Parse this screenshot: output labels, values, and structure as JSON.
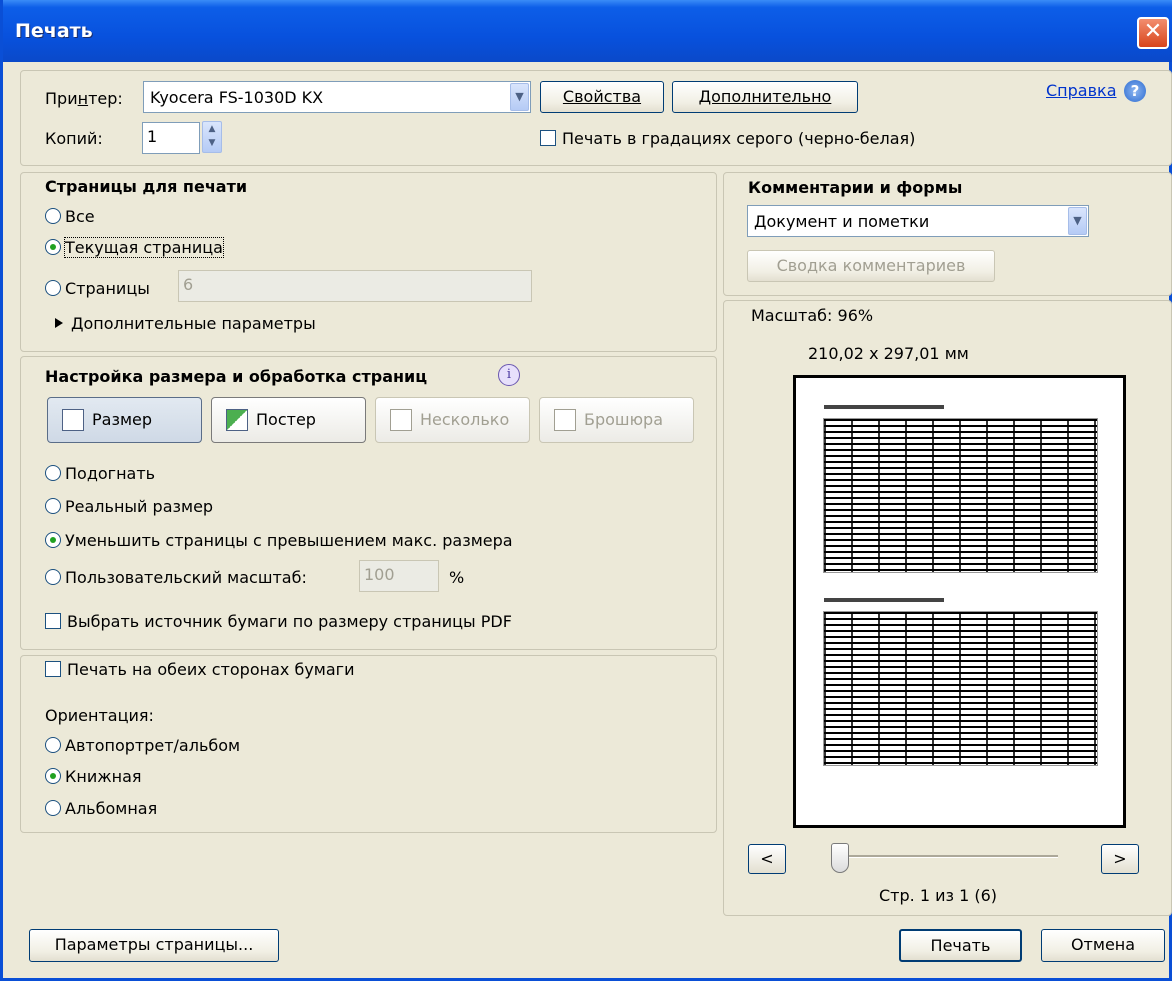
{
  "window": {
    "title": "Печать",
    "close_label": "✕"
  },
  "printer": {
    "label": "Принтер:",
    "value": "Kyocera FS-1030D KX",
    "properties_button": "Свойства",
    "advanced_button": "Дополнительно",
    "help_link": "Справка",
    "copies_label": "Копий:",
    "copies_value": "1",
    "grayscale_label": "Печать в градациях серого (черно-белая)"
  },
  "pages": {
    "heading": "Страницы для печати",
    "all": "Все",
    "current": "Текущая страница",
    "range": "Страницы",
    "range_value": "6",
    "more_options": "Дополнительные параметры"
  },
  "sizing": {
    "heading": "Настройка размера и обработка страниц",
    "btn_size": "Размер",
    "btn_poster": "Постер",
    "btn_multiple": "Несколько",
    "btn_booklet": "Брошюра",
    "fit": "Подогнать",
    "actual": "Реальный размер",
    "shrink": "Уменьшить страницы с превышением макс. размера",
    "custom": "Пользовательский масштаб:",
    "custom_value": "100",
    "percent": "%",
    "paper_source": "Выбрать источник бумаги по размеру страницы PDF"
  },
  "duplex": {
    "both_sides": "Печать на обеих сторонах бумаги",
    "orientation_label": "Ориентация:",
    "auto": "Автопортрет/альбом",
    "portrait": "Книжная",
    "landscape": "Альбомная"
  },
  "comments": {
    "heading": "Комментарии и формы",
    "value": "Документ и пометки",
    "summary_button": "Сводка комментариев"
  },
  "preview": {
    "scale": "Масштаб:  96%",
    "dimensions": "210,02 x 297,01 мм",
    "prev": "<",
    "next": ">",
    "page_info": "Стр. 1 из 1 (6)"
  },
  "footer": {
    "page_setup": "Параметры страницы...",
    "print": "Печать",
    "cancel": "Отмена"
  },
  "colors": {
    "title_bar": "#0851dd",
    "dialog_bg": "#ece9d8",
    "radio_dot": "#21a121"
  }
}
